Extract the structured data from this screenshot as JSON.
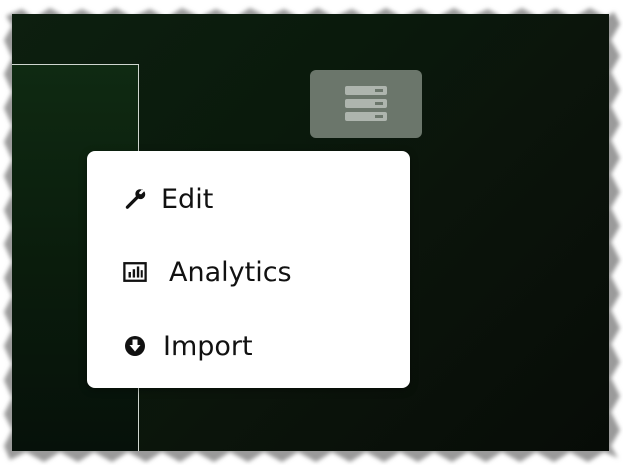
{
  "menu": {
    "items": [
      {
        "label": "Edit",
        "icon": "wrench-icon"
      },
      {
        "label": "Analytics",
        "icon": "bar-chart-icon"
      },
      {
        "label": "Import",
        "icon": "download-circle-icon"
      }
    ]
  },
  "toolbar": {
    "toggle_icon": "server-list-icon"
  },
  "colors": {
    "background": "#0a1a0c",
    "menu_background": "#ffffff",
    "button_background": "#6b766b",
    "text": "#111111"
  }
}
